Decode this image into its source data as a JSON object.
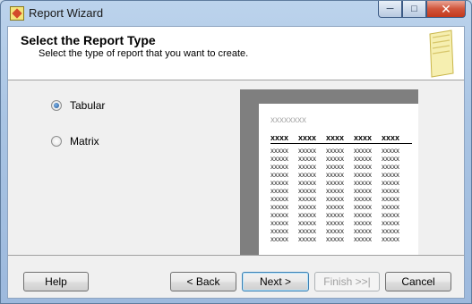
{
  "window": {
    "title": "Report Wizard"
  },
  "header": {
    "title": "Select the Report Type",
    "subtitle": "Select the type of report that you want to create."
  },
  "options": [
    {
      "label": "Tabular",
      "checked": true
    },
    {
      "label": "Matrix",
      "checked": false
    }
  ],
  "preview": {
    "title": "xxxxxxxx",
    "headers": [
      "xxxx",
      "xxxx",
      "xxxx",
      "xxxx",
      "xxxx"
    ],
    "cell_text": "xxxxx",
    "row_count": 12
  },
  "buttons": {
    "help": "Help",
    "back": "< Back",
    "next": "Next >",
    "finish": "Finish >>|",
    "cancel": "Cancel"
  },
  "colors": {
    "accent": "#3c7fb1",
    "close": "#c3391c"
  }
}
